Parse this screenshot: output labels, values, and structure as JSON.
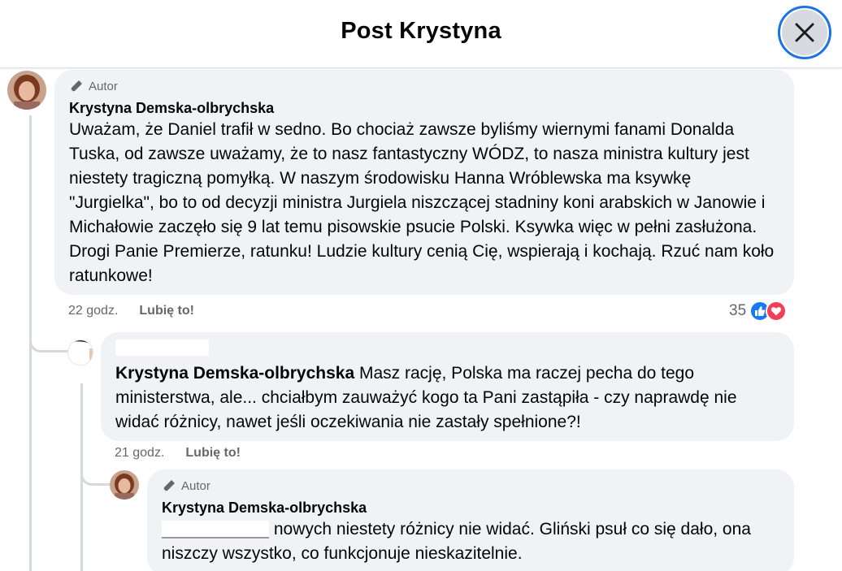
{
  "header": {
    "title": "Post Krystyna",
    "close_icon": "close-icon"
  },
  "comments": [
    {
      "badge": "Autor",
      "author": "Krystyna Demska-olbrychska",
      "text": "Uważam, że Daniel trafił w sedno. Bo chociaż zawsze byliśmy wiernymi fanami Donalda Tuska, od zawsze uważamy, że to nasz fantastyczny WÓDZ, to nasza ministra kultury jest niestety tragiczną pomyłką. W naszym środowisku Hanna Wróblewska ma ksywkę \"Jurgielka\", bo to od decyzji ministra Jurgiela niszczącej stadniny koni arabskich w Janowie i Michałowie zaczęło się 9 lat temu pisowskie psucie Polski. Ksywka więc w pełni zasłużona. Drogi Panie Premierze, ratunku! Ludzie kultury cenią Cię, wspierają i kochają. Rzuć nam koło ratunkowe!",
      "time": "22 godz.",
      "like_label": "Lubię to!",
      "reaction_count": "35",
      "reaction_icons": [
        "like-icon",
        "love-icon"
      ]
    },
    {
      "mention": "Krystyna Demska-olbrychska",
      "text": " Masz rację, Polska ma raczej pecha do tego ministerstwa, ale... chciałbym zauważyć kogo ta Pani zastąpiła - czy naprawdę nie widać różnicy, nawet jeśli oczekiwania nie zastały spełnione?!",
      "time": "21 godz.",
      "like_label": "Lubię to!"
    },
    {
      "badge": "Autor",
      "author": "Krystyna Demska-olbrychska",
      "text_rest": " nowych niestety różnicy nie widać. Gliński psuł co się dało, ona niszczy wszystko, co funkcjonuje nieskazitelnie."
    }
  ],
  "colors": {
    "bubble": "#f0f2f5",
    "accent": "#1b74e4",
    "like_blue": "#1877f2",
    "love_red": "#f33e58",
    "muted_text": "#65676b"
  }
}
